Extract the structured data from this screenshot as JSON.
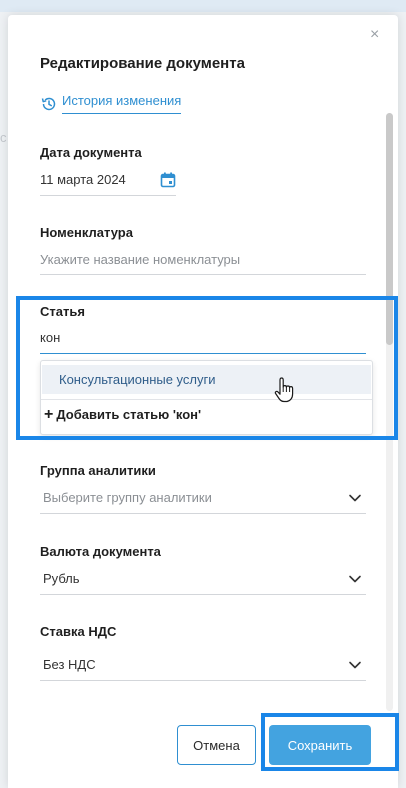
{
  "background": {
    "fragment_text": "c"
  },
  "modal": {
    "title": "Редактирование документа",
    "close_label": "×",
    "history_link": "История изменения"
  },
  "fields": {
    "date": {
      "label": "Дата документа",
      "value": "11 марта 2024"
    },
    "nomenclature": {
      "label": "Номенклатура",
      "placeholder": "Укажите название номенклатуры"
    },
    "article": {
      "label": "Статья",
      "value": "кон",
      "dropdown": {
        "options": [
          "Консультационные услуги"
        ],
        "add_label": "Добавить статью 'кон'"
      }
    },
    "analytics_group": {
      "label": "Группа аналитики",
      "placeholder": "Выберите группу аналитики"
    },
    "currency": {
      "label": "Валюта документа",
      "value": "Рубль"
    },
    "vat": {
      "label": "Ставка НДС",
      "value": "Без НДС"
    }
  },
  "buttons": {
    "cancel": "Отмена",
    "save": "Сохранить"
  },
  "colors": {
    "accent": "#2f8fd1",
    "primary_button": "#43a3e0",
    "focus_highlight": "#1a86e8"
  }
}
